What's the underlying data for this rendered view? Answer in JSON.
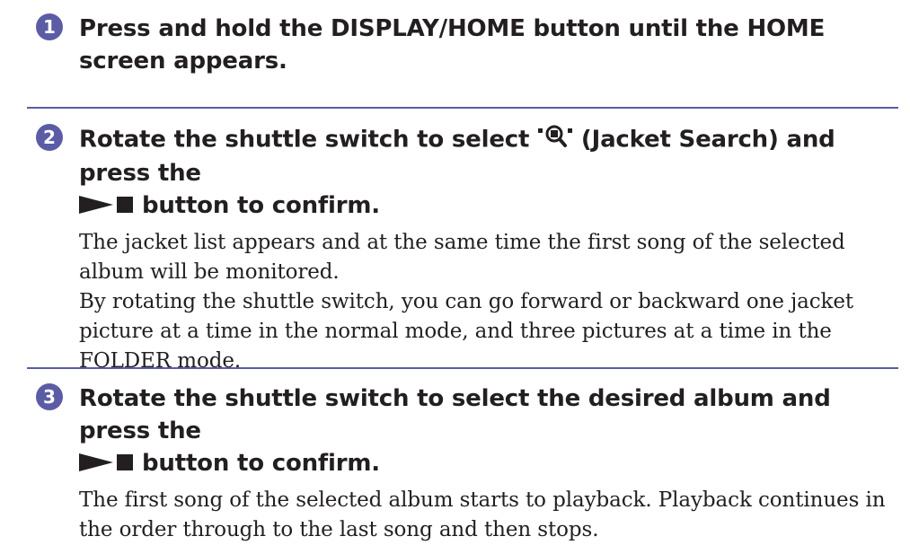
{
  "steps": [
    {
      "number": "1",
      "title": "Press and hold the DISPLAY/HOME button until the HOME screen appears."
    },
    {
      "number": "2",
      "title_before_icon": "Rotate the shuttle switch to select",
      "title_after_icon": "(Jacket Search) and press the",
      "title_end": "button to confirm.",
      "body": [
        "The jacket list appears and at the same time the first song of the selected album will be monitored.",
        "By rotating the shuttle switch, you can go forward or backward one jacket picture at a time in the normal mode, and three pictures at a time in the FOLDER mode."
      ]
    },
    {
      "number": "3",
      "title_start": "Rotate the shuttle switch to select the desired album and press the",
      "title_end": "button to confirm.",
      "body": [
        "The first song of the selected album starts to playback. Playback continues in the order through to the last song and then stops."
      ]
    }
  ],
  "icons": {
    "step_number_circle": "filled-circle",
    "jacket_search": "jacket-search-icon",
    "play_stop": "play-stop-icon"
  },
  "colors": {
    "accent": "#5b5ba6",
    "text": "#231f20",
    "background": "#ffffff"
  }
}
